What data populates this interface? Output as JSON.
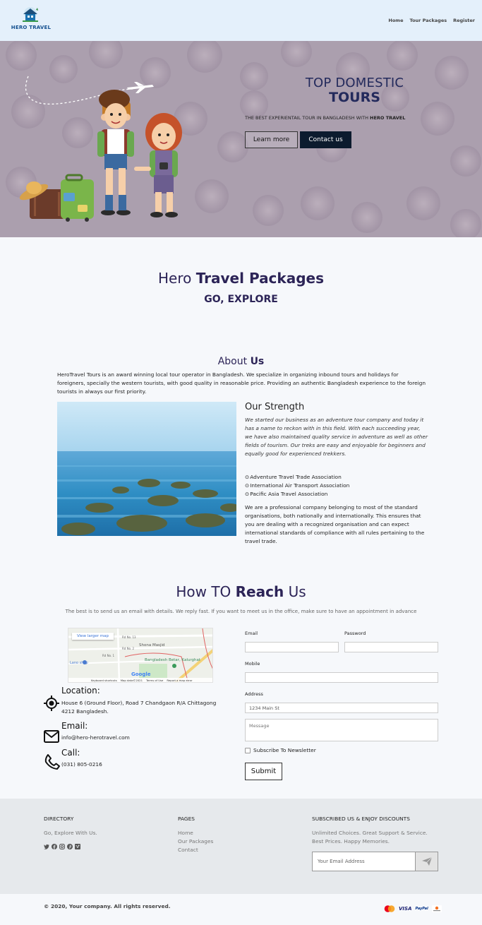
{
  "brand": {
    "name": "HERO TRAVEL"
  },
  "nav": [
    {
      "label": "Home"
    },
    {
      "label": "Tour Packages"
    },
    {
      "label": "Register"
    }
  ],
  "hero": {
    "title_line1": "TOP DOMESTIC",
    "title_line2": "TOURS",
    "subtitle_prefix": "THE BEST EXPERIENTAIL TOUR IN BANGLADESH WITH ",
    "subtitle_brand": "HERO TRAVEL",
    "learn_more": "Learn more",
    "contact_us": "Contact us"
  },
  "packages": {
    "title_plain": "Hero ",
    "title_bold": "Travel Packages",
    "subtitle": "GO, EXPLORE"
  },
  "about": {
    "title_plain": "About ",
    "title_bold": "Us",
    "text": "HeroTravel Tours is an award winning local tour operator in Bangladesh. We specialize in organizing inbound tours and holidays for foreigners, specially the western tourists, with good quality in reasonable price. Providing an authentic Bangladesh experience to the foreign tourists in always our first priority.",
    "strength_title": "Our Strength",
    "strength_desc": "We started our business as an adventure tour company and today it has a name to reckon with in this field. With each succeeding year, we have also maintained quality service in adventure as well as other fields of tourism. Our treks are easy and enjoyable for beginners and equally good for experienced trekkers.",
    "associations": [
      "Adventure Travel Trade Association",
      "International Air Transport Association",
      "Pacific Asia Travel Association"
    ],
    "professional": "We are a professional company belonging to most of the standard organisations, both nationally and internationally. This ensures that you are dealing with a recognized organisation and can expect international standards of compliance with all rules pertaining to the travel trade."
  },
  "reach": {
    "title_plain1": "How TO ",
    "title_bold": "Reach",
    "title_plain2": " Us",
    "subtitle": "The best is to send us an email with details. We reply fast. If you want to meet us in the office, make sure to have an appointment in advance",
    "map": {
      "view_larger": "View larger map",
      "labels": [
        "Rd No. 13",
        "Shona Masjid",
        "Rd No. 2",
        "Rd No. 1",
        "Bangladesh Betar, Kalurghat",
        "Lano shop",
        "Google"
      ],
      "footer": [
        "Keyboard shortcuts",
        "Map data©2021",
        "Terms of Use",
        "Report a map error"
      ]
    },
    "location_label": "Location:",
    "location_value": "House 6 (Ground Floor), Road 7 Chandgaon R/A Chittagong 4212 Bangladesh.",
    "email_label": "Email:",
    "email_value": "info@hero-herotravel.com",
    "call_label": "Call:",
    "call_value": "(031) 805-0216"
  },
  "form": {
    "email_label": "Email",
    "password_label": "Password",
    "mobile_label": "Mobile",
    "address_label": "Address",
    "address_placeholder": "1234 Main St",
    "message_placeholder": "Message",
    "subscribe_label": "Subscribe To Newsletter",
    "submit": "Submit"
  },
  "footer": {
    "directory_title": "DIRECTORY",
    "directory_text": "Go, Explore With Us.",
    "social_icons": [
      "twitter-icon",
      "facebook-icon",
      "instagram-icon",
      "pinterest-icon",
      "vimeo-icon"
    ],
    "pages_title": "PAGES",
    "pages": [
      "Home",
      "Our Packages",
      "Contact"
    ],
    "subscribe_title": "SUBSCRIBED US & ENJOY DISCOUNTS",
    "subscribe_text": "Unlimited Choices. Great Support & Service. Best Prices. Happy Memories.",
    "email_placeholder": "Your Email Address",
    "copyright": "© 2020, Your company. All rights reserved.",
    "payment_icons": [
      "mastercard-icon",
      "visa-icon",
      "paypal-icon",
      "discover-icon"
    ],
    "visa": "VISA",
    "paypal": "PayPal"
  },
  "colors": {
    "nav_bg": "#e4f0fb",
    "heading": "#2c2457",
    "hero_title": "#232a5c",
    "contact_btn": "#0c1b2e",
    "footer_bg": "#e6e9ec"
  }
}
